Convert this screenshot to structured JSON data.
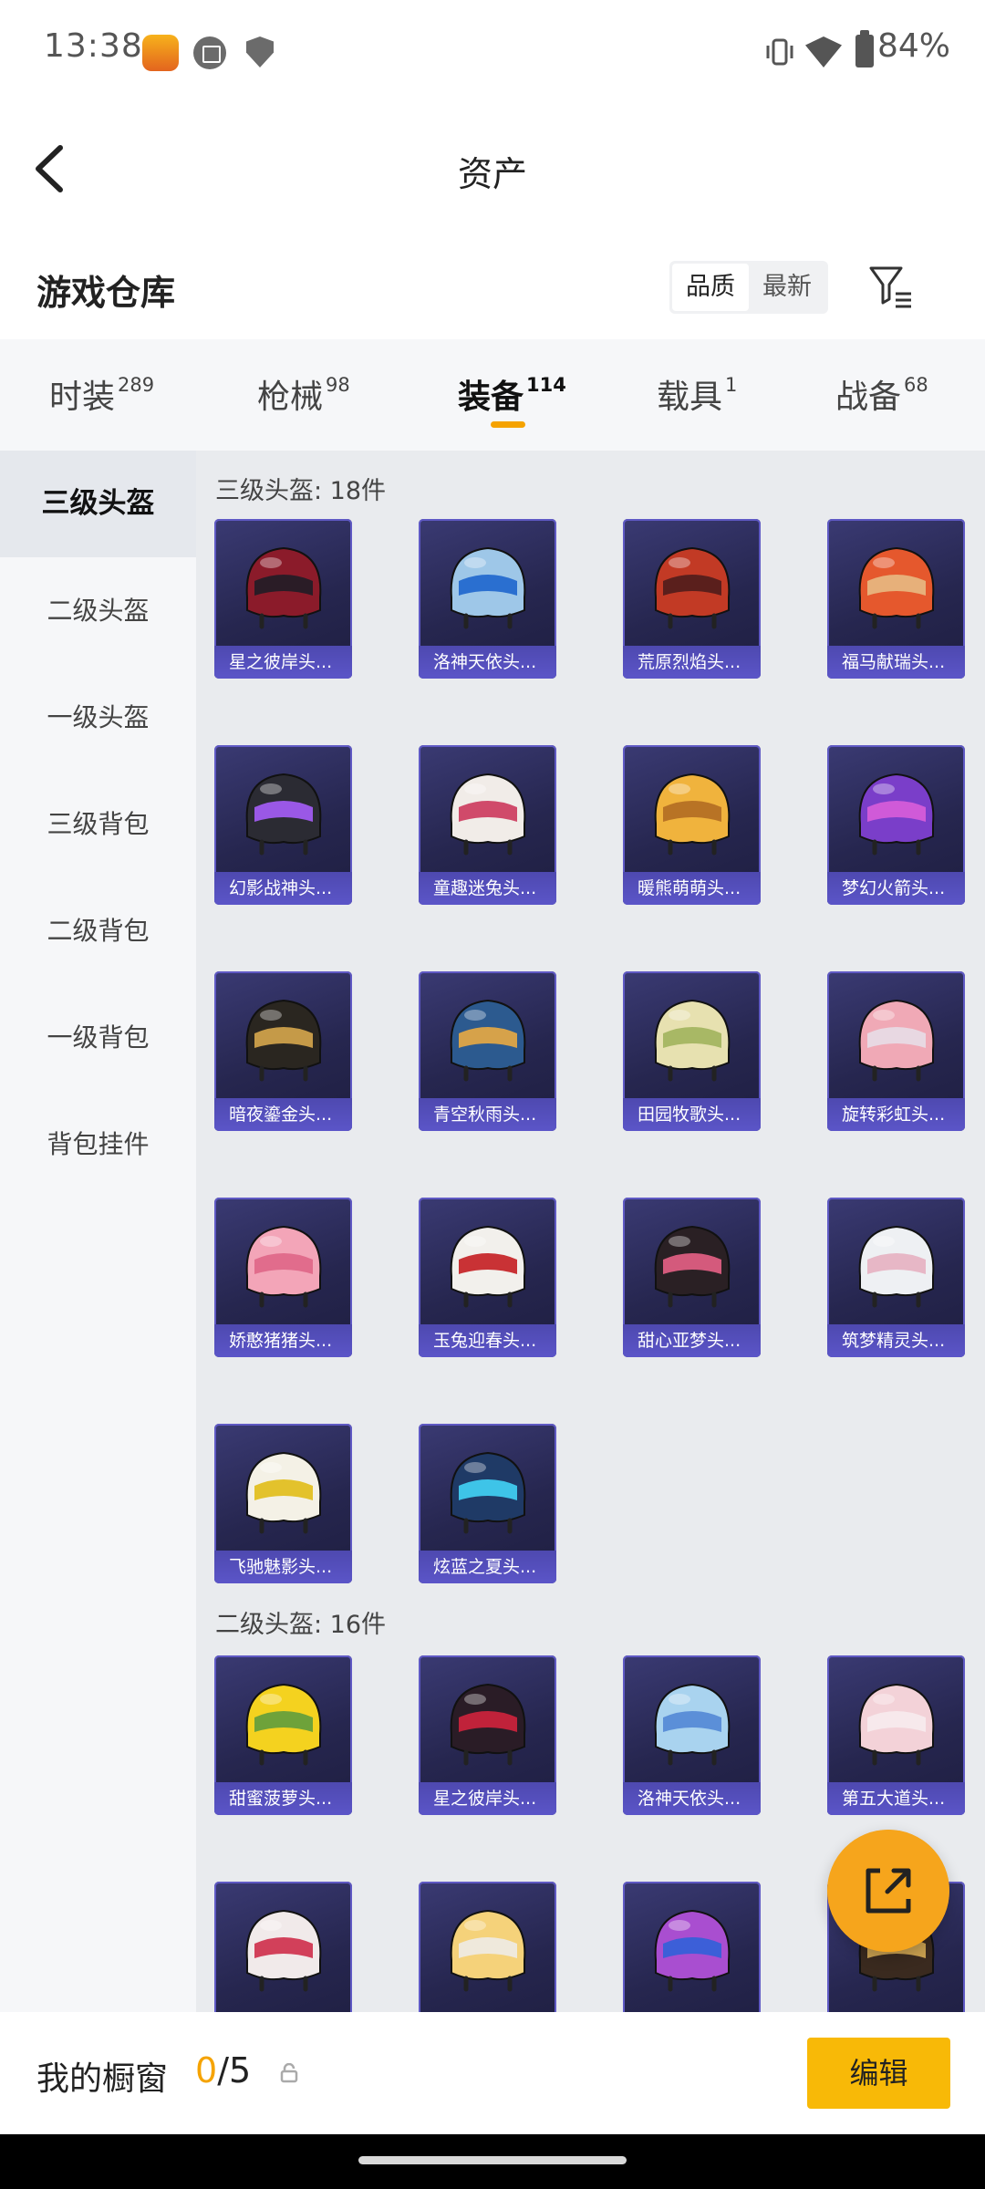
{
  "status_bar": {
    "time": "13:38",
    "battery": "84%"
  },
  "header": {
    "title": "资产"
  },
  "section": {
    "title": "游戏仓库",
    "sort_options": [
      "品质",
      "最新"
    ],
    "sort_active": "品质"
  },
  "tabs": [
    {
      "label": "时装",
      "count": "289"
    },
    {
      "label": "枪械",
      "count": "98"
    },
    {
      "label": "装备",
      "count": "114",
      "active": true
    },
    {
      "label": "载具",
      "count": "1"
    },
    {
      "label": "战备",
      "count": "68"
    }
  ],
  "sidebar": [
    "三级头盔",
    "二级头盔",
    "一级头盔",
    "三级背包",
    "二级背包",
    "一级背包",
    "背包挂件"
  ],
  "sidebar_active": "三级头盔",
  "groups": [
    {
      "title": "三级头盔: 18件",
      "items": [
        {
          "name": "星之彼岸头...",
          "colors": [
            "#8b1b2a",
            "#2a1c26"
          ]
        },
        {
          "name": "洛神天依头...",
          "colors": [
            "#9ec7e8",
            "#2a6fd0"
          ]
        },
        {
          "name": "荒原烈焰头...",
          "colors": [
            "#c23a25",
            "#5a1f1c"
          ]
        },
        {
          "name": "福马献瑞头...",
          "colors": [
            "#e5582d",
            "#e7b07a"
          ]
        },
        {
          "name": "幻影战神头...",
          "colors": [
            "#2b2b33",
            "#9a58e6"
          ]
        },
        {
          "name": "童趣迷兔头...",
          "colors": [
            "#f1ece8",
            "#d04a6a"
          ]
        },
        {
          "name": "暖熊萌萌头...",
          "colors": [
            "#f0b33d",
            "#b87325"
          ]
        },
        {
          "name": "梦幻火箭头...",
          "colors": [
            "#7a3ec9",
            "#d05ad8"
          ]
        },
        {
          "name": "暗夜鎏金头...",
          "colors": [
            "#2a2620",
            "#c59a48"
          ]
        },
        {
          "name": "青空秋雨头...",
          "colors": [
            "#2c5a8f",
            "#d6a24a"
          ]
        },
        {
          "name": "田园牧歌头...",
          "colors": [
            "#e7e1b0",
            "#a8b865"
          ]
        },
        {
          "name": "旋转彩虹头...",
          "colors": [
            "#f0a9b6",
            "#e8d8e2"
          ]
        },
        {
          "name": "娇憨猪猪头...",
          "colors": [
            "#f3a5b8",
            "#e16c8c"
          ]
        },
        {
          "name": "玉兔迎春头...",
          "colors": [
            "#f2f0ec",
            "#c93235"
          ]
        },
        {
          "name": "甜心亚梦头...",
          "colors": [
            "#2a2024",
            "#d45a7c"
          ]
        },
        {
          "name": "筑梦精灵头...",
          "colors": [
            "#eef0f3",
            "#e7b7c6"
          ]
        },
        {
          "name": "飞驰魅影头...",
          "colors": [
            "#f4f1e6",
            "#e3c22c"
          ]
        },
        {
          "name": "炫蓝之夏头...",
          "colors": [
            "#1f3a66",
            "#3ec4e8"
          ]
        }
      ]
    },
    {
      "title": "二级头盔: 16件",
      "items": [
        {
          "name": "甜蜜菠萝头...",
          "colors": [
            "#f4d21f",
            "#6ea23a"
          ]
        },
        {
          "name": "星之彼岸头...",
          "colors": [
            "#2a1c26",
            "#c0223a"
          ]
        },
        {
          "name": "洛神天依头...",
          "colors": [
            "#a9d3ef",
            "#5b8fd8"
          ]
        },
        {
          "name": "第五大道头...",
          "colors": [
            "#f3d2d8",
            "#f7e9ec"
          ]
        },
        {
          "name": "",
          "colors": [
            "#f1eaea",
            "#d2405a"
          ]
        },
        {
          "name": "",
          "colors": [
            "#f5d27a",
            "#efe9dc"
          ]
        },
        {
          "name": "",
          "colors": [
            "#a94ed0",
            "#3c5fd8"
          ]
        },
        {
          "name": "",
          "colors": [
            "#3a2a1f",
            "#c9a050"
          ]
        }
      ]
    }
  ],
  "bottom_bar": {
    "label": "我的橱窗",
    "current": "0",
    "total": "/5",
    "edit_label": "编辑"
  },
  "colors": {
    "accent": "#f5a300",
    "card_bg": "#2a2a58",
    "card_label": "#5550c2"
  }
}
